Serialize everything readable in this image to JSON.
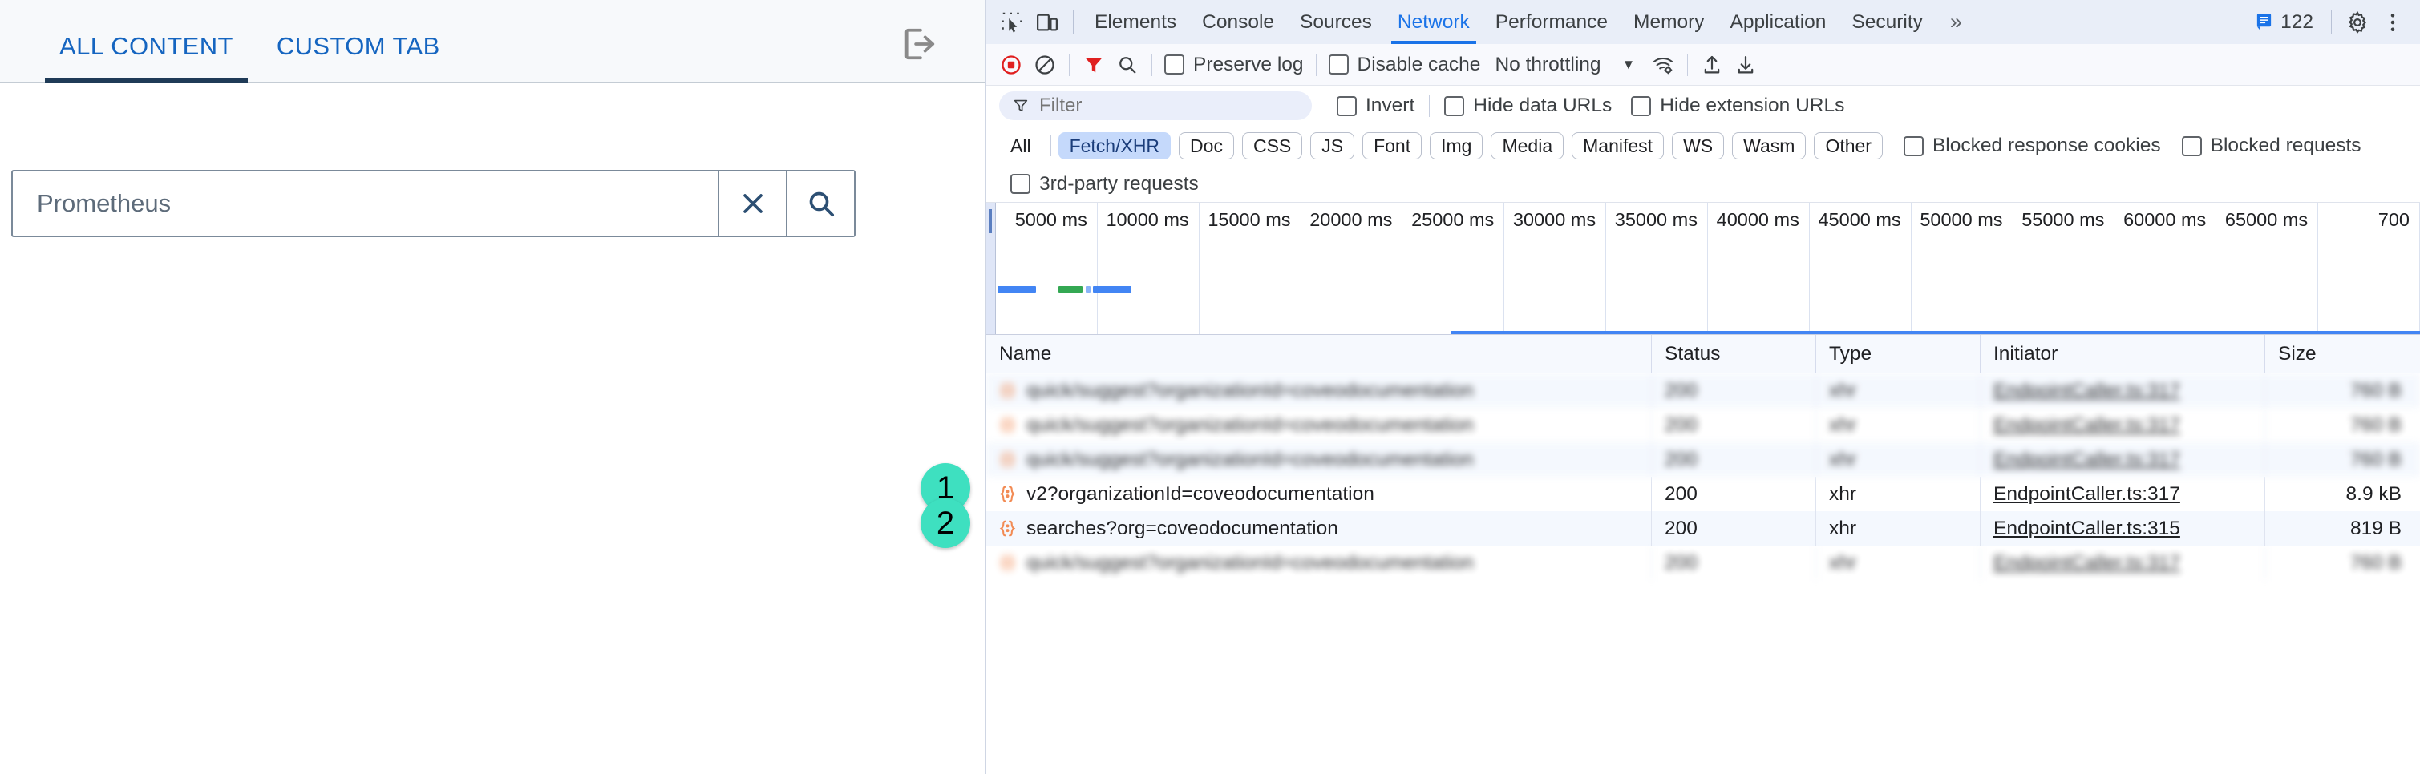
{
  "app": {
    "tabs": [
      {
        "label": "ALL CONTENT",
        "active": true
      },
      {
        "label": "CUSTOM TAB",
        "active": false
      }
    ],
    "logout_icon": "logout-icon",
    "search": {
      "value": "Prometheus",
      "placeholder": "",
      "clear_icon": "close-icon",
      "search_icon": "search-icon"
    }
  },
  "devtools": {
    "left_icons": [
      "inspect-element-icon",
      "device-toolbar-icon"
    ],
    "tabs": [
      {
        "label": "Elements",
        "active": false
      },
      {
        "label": "Console",
        "active": false
      },
      {
        "label": "Sources",
        "active": false
      },
      {
        "label": "Network",
        "active": true
      },
      {
        "label": "Performance",
        "active": false
      },
      {
        "label": "Memory",
        "active": false
      },
      {
        "label": "Application",
        "active": false
      },
      {
        "label": "Security",
        "active": false
      }
    ],
    "more_tabs": "»",
    "issues_count": "122",
    "settings_icon": "gear-icon",
    "kebab_icon": "more-vertical-icon",
    "toolbar": {
      "record_icon": "record-stop-icon",
      "clear_icon": "clear-no-entry-icon",
      "filter_icon": "filter-funnel-icon",
      "search_icon": "search-icon",
      "preserve_log_label": "Preserve log",
      "disable_cache_label": "Disable cache",
      "throttling_value": "No throttling",
      "throttle_caret_icon": "chevron-down-icon",
      "network_conditions_icon": "wifi-settings-icon",
      "import_har_icon": "upload-arrow-icon",
      "export_har_icon": "download-arrow-icon"
    },
    "filter_row": {
      "filter_placeholder": "Filter",
      "filter_value": "",
      "filter_icon": "filter-funnel-icon",
      "invert_label": "Invert",
      "hide_data_urls_label": "Hide data URLs",
      "hide_extension_urls_label": "Hide extension URLs"
    },
    "type_chips": [
      {
        "label": "All",
        "selected": false
      },
      {
        "label": "Fetch/XHR",
        "selected": true
      },
      {
        "label": "Doc",
        "selected": false
      },
      {
        "label": "CSS",
        "selected": false
      },
      {
        "label": "JS",
        "selected": false
      },
      {
        "label": "Font",
        "selected": false
      },
      {
        "label": "Img",
        "selected": false
      },
      {
        "label": "Media",
        "selected": false
      },
      {
        "label": "Manifest",
        "selected": false
      },
      {
        "label": "WS",
        "selected": false
      },
      {
        "label": "Wasm",
        "selected": false
      },
      {
        "label": "Other",
        "selected": false
      }
    ],
    "blocked_response_cookies_label": "Blocked response cookies",
    "blocked_requests_label": "Blocked requests",
    "third_party_label": "3rd-party requests",
    "timeline": {
      "ticks": [
        "5000 ms",
        "10000 ms",
        "15000 ms",
        "20000 ms",
        "25000 ms",
        "30000 ms",
        "35000 ms",
        "40000 ms",
        "45000 ms",
        "50000 ms",
        "55000 ms",
        "60000 ms",
        "65000 ms",
        "700"
      ]
    },
    "table": {
      "columns": [
        "Name",
        "Status",
        "Type",
        "Initiator",
        "Size"
      ],
      "rows": [
        {
          "name": "",
          "status": "",
          "type": "",
          "initiator": "",
          "size": "",
          "blurred": true,
          "alt": true
        },
        {
          "name": "",
          "status": "",
          "type": "",
          "initiator": "",
          "size": "",
          "blurred": true,
          "alt": false
        },
        {
          "name": "",
          "status": "",
          "type": "",
          "initiator": "",
          "size": "",
          "blurred": true,
          "alt": true
        },
        {
          "name": "v2?organizationId=coveodocumentation",
          "status": "200",
          "type": "xhr",
          "initiator": "EndpointCaller.ts:317",
          "size": "8.9 kB",
          "blurred": false,
          "alt": false
        },
        {
          "name": "searches?org=coveodocumentation",
          "status": "200",
          "type": "xhr",
          "initiator": "EndpointCaller.ts:315",
          "size": "819 B",
          "blurred": false,
          "alt": true
        },
        {
          "name": "",
          "status": "",
          "type": "",
          "initiator": "",
          "size": "",
          "blurred": true,
          "alt": false
        }
      ]
    }
  },
  "callouts": [
    {
      "label": "1"
    },
    {
      "label": "2"
    }
  ],
  "colors": {
    "accent_blue": "#1a73e8",
    "app_tab_blue": "#1565c0",
    "app_tab_underline": "#1f3b57",
    "chip_selected_bg": "#c5d9fb",
    "callout_bg": "#3ee0c0",
    "record_red": "#e02020",
    "timeline_blue": "#4285f4",
    "timeline_green": "#34a853"
  }
}
